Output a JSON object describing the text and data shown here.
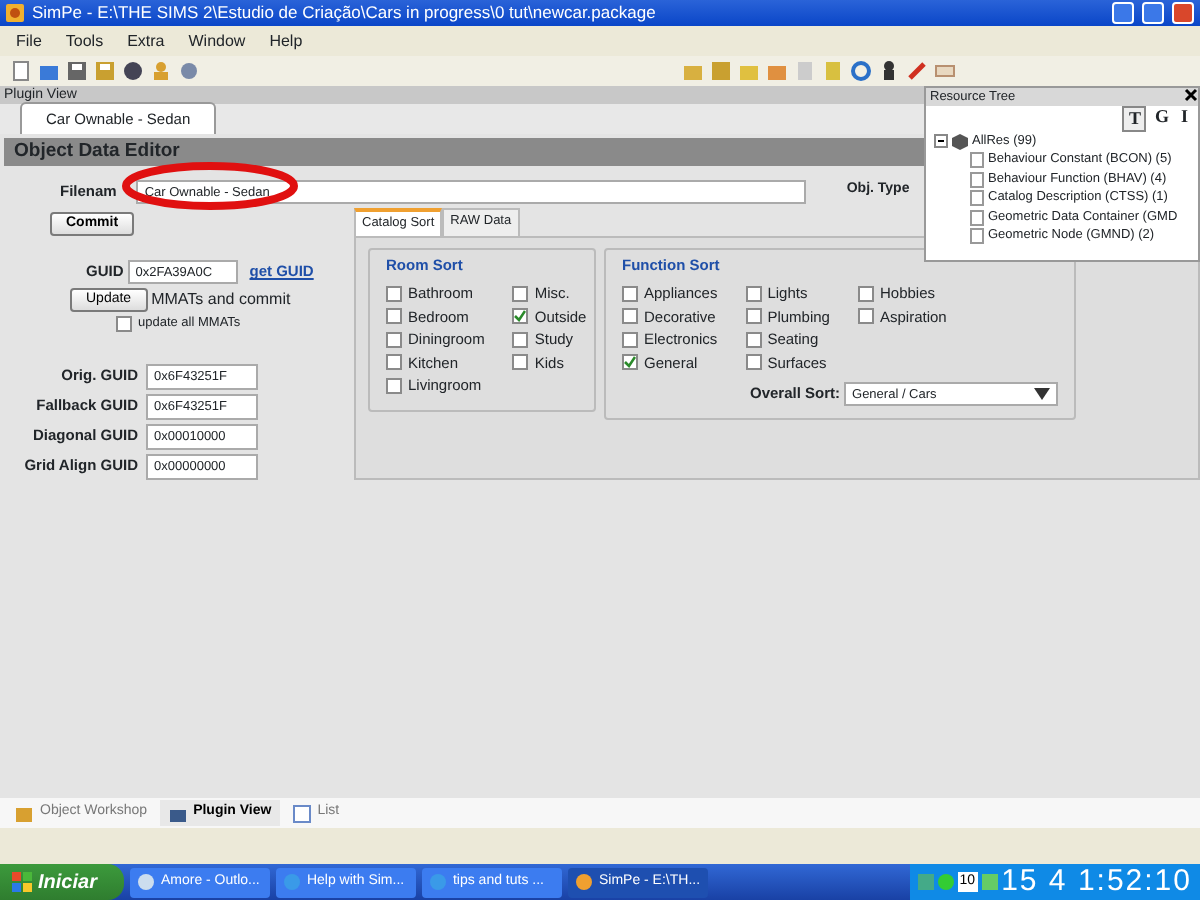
{
  "window": {
    "title": "SimPe - E:\\THE SIMS 2\\Estudio de Criação\\Cars in progress\\0 tut\\newcar.package"
  },
  "menu": [
    "File",
    "Tools",
    "Extra",
    "Window",
    "Help"
  ],
  "plugin_view": {
    "title": "Plugin View",
    "tabs": [
      {
        "label": "Car Ownable - Sedan",
        "selected": true
      }
    ]
  },
  "editor": {
    "title": "Object Data Editor",
    "filename_label": "Filenam",
    "filename": "Car Ownable - Sedan",
    "obj_type_label": "Obj. Type",
    "commit": "Commit",
    "guid_label": "GUID",
    "guid": "0x2FA39A0C",
    "get_guid": "get GUID",
    "update": "Update",
    "update_text": "MMATs and commit",
    "update_all": {
      "label": "update all MMATs",
      "checked": false
    },
    "guids": [
      {
        "label": "Orig. GUID",
        "value": "0x6F43251F"
      },
      {
        "label": "Fallback GUID",
        "value": "0x6F43251F"
      },
      {
        "label": "Diagonal GUID",
        "value": "0x00010000"
      },
      {
        "label": "Grid Align GUID",
        "value": "0x00000000"
      }
    ],
    "tabs": [
      {
        "label": "Catalog Sort",
        "selected": true
      },
      {
        "label": "RAW Data",
        "selected": false
      }
    ],
    "room_sort": {
      "title": "Room Sort",
      "items": [
        {
          "label": "Bathroom",
          "checked": false
        },
        {
          "label": "Bedroom",
          "checked": false
        },
        {
          "label": "Diningroom",
          "checked": false
        },
        {
          "label": "Kitchen",
          "checked": false
        },
        {
          "label": "Livingroom",
          "checked": false
        },
        {
          "label": "Misc.",
          "checked": false
        },
        {
          "label": "Outside",
          "checked": true
        },
        {
          "label": "Study",
          "checked": false
        },
        {
          "label": "Kids",
          "checked": false
        }
      ]
    },
    "function_sort": {
      "title": "Function Sort",
      "items": [
        {
          "label": "Appliances",
          "checked": false
        },
        {
          "label": "Decorative",
          "checked": false
        },
        {
          "label": "Electronics",
          "checked": false
        },
        {
          "label": "General",
          "checked": true
        },
        {
          "label": "Lights",
          "checked": false
        },
        {
          "label": "Plumbing",
          "checked": false
        },
        {
          "label": "Seating",
          "checked": false
        },
        {
          "label": "Surfaces",
          "checked": false
        },
        {
          "label": "Hobbies",
          "checked": false
        },
        {
          "label": "Aspiration",
          "checked": false
        }
      ],
      "overall_label": "Overall Sort:",
      "overall": "General / Cars"
    }
  },
  "resource_tree": {
    "title": "Resource Tree",
    "view_buttons": [
      {
        "label": "T",
        "selected": true
      },
      {
        "label": "G",
        "selected": false
      },
      {
        "label": "I",
        "selected": false
      }
    ],
    "root": {
      "label": "AllRes (99)",
      "expanded": true,
      "children": [
        {
          "label": "Behaviour Constant (BCON) (5)"
        },
        {
          "label": "Behaviour Function (BHAV) (4)"
        },
        {
          "label": "Catalog Description (CTSS) (1)"
        },
        {
          "label": "Geometric Data Container (GMD"
        },
        {
          "label": "Geometric Node (GMND) (2)"
        }
      ]
    }
  },
  "bottom_tabs": [
    {
      "label": "Object Workshop",
      "selected": false
    },
    {
      "label": "Plugin View",
      "selected": true
    },
    {
      "label": "List",
      "selected": false
    }
  ],
  "taskbar": {
    "start": "Iniciar",
    "tasks": [
      {
        "label": "Amore - Outlo...",
        "selected": false
      },
      {
        "label": "Help with Sim...",
        "selected": false
      },
      {
        "label": "tips and tuts ...",
        "selected": false
      },
      {
        "label": "SimPe - E:\\TH...",
        "selected": true
      }
    ],
    "tray_text": "10",
    "clock": "15 4 1:52:10"
  }
}
